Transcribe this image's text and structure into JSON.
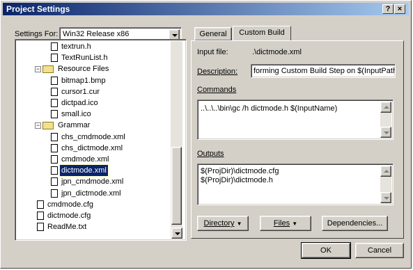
{
  "window": {
    "title": "Project Settings",
    "help": "?",
    "close": "×"
  },
  "settings_for": {
    "label": "Settings For:",
    "value": "Win32 Release x86"
  },
  "tree": [
    {
      "label": "textrun.h",
      "type": "file"
    },
    {
      "label": "TextRunList.h",
      "type": "file"
    },
    {
      "label": "Resource Files",
      "type": "folder"
    },
    {
      "label": "bitmap1.bmp",
      "type": "file"
    },
    {
      "label": "cursor1.cur",
      "type": "file"
    },
    {
      "label": "dictpad.ico",
      "type": "file"
    },
    {
      "label": "small.ico",
      "type": "file"
    },
    {
      "label": "Grammar",
      "type": "folder"
    },
    {
      "label": "chs_cmdmode.xml",
      "type": "file"
    },
    {
      "label": "chs_dictmode.xml",
      "type": "file"
    },
    {
      "label": "cmdmode.xml",
      "type": "file"
    },
    {
      "label": "dictmode.xml",
      "type": "file",
      "selected": true
    },
    {
      "label": "jpn_cmdmode.xml",
      "type": "file"
    },
    {
      "label": "jpn_dictmode.xml",
      "type": "file"
    },
    {
      "label": "cmdmode.cfg",
      "type": "file"
    },
    {
      "label": "dictmode.cfg",
      "type": "file"
    },
    {
      "label": "ReadMe.txt",
      "type": "file"
    }
  ],
  "tabs": {
    "general": "General",
    "custom_build": "Custom Build"
  },
  "input_file": {
    "label": "Input file:",
    "value": ".\\dictmode.xml"
  },
  "description": {
    "label": "Description:",
    "value": "forming Custom Build Step on $(InputPath)"
  },
  "commands": {
    "label": "Commands",
    "text": "..\\..\\..\\bin\\gc /h dictmode.h  $(InputName)"
  },
  "outputs": {
    "label": "Outputs",
    "lines": [
      "$(ProjDir)\\dictmode.cfg",
      "$(ProjDir)\\dictmode.h"
    ]
  },
  "buttons": {
    "directory": "Directory",
    "files": "Files",
    "dependencies": "Dependencies...",
    "ok": "OK",
    "cancel": "Cancel"
  },
  "colors": {
    "title_start": "#0a246a",
    "title_end": "#a6caf0",
    "selection": "#0a246a",
    "face": "#d4d0c8"
  }
}
